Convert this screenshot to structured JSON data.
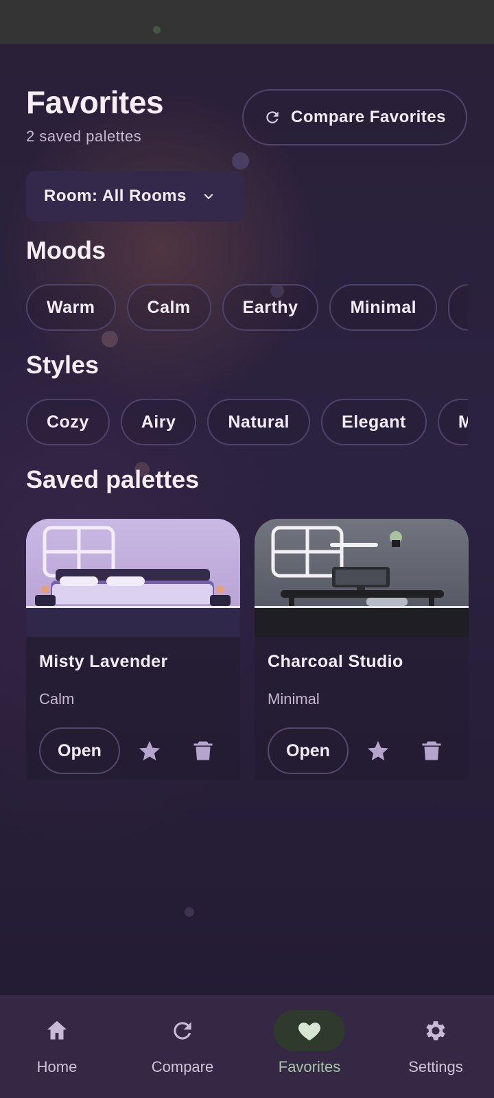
{
  "header": {
    "title": "Favorites",
    "subtitle": "2 saved palettes",
    "compare_button_label": "Compare Favorites",
    "compare_icon": "refresh-icon"
  },
  "room_filter": {
    "label": "Room: All Rooms",
    "icon": "chevron-down-icon"
  },
  "moods": {
    "title": "Moods",
    "chips": [
      "Warm",
      "Calm",
      "Earthy",
      "Minimal",
      ""
    ]
  },
  "styles": {
    "title": "Styles",
    "chips": [
      "Cozy",
      "Airy",
      "Natural",
      "Elegant",
      "M"
    ]
  },
  "saved": {
    "title": "Saved palettes",
    "cards": [
      {
        "name": "Misty Lavender",
        "mood": "Calm",
        "open_label": "Open",
        "image": "lavender-bedroom-illustration"
      },
      {
        "name": "Charcoal Studio",
        "mood": "Minimal",
        "open_label": "Open",
        "image": "charcoal-living-room-illustration"
      }
    ]
  },
  "bottom_nav": {
    "items": [
      {
        "label": "Home",
        "icon": "home-icon"
      },
      {
        "label": "Compare",
        "icon": "refresh-icon"
      },
      {
        "label": "Favorites",
        "icon": "heart-icon",
        "active": true
      },
      {
        "label": "Settings",
        "icon": "gear-icon"
      }
    ]
  },
  "colors": {
    "background": "#211a30",
    "accent_nav": "#a9c4a4",
    "chip_border": "#4f4268",
    "lavender": "#c9b8e0",
    "charcoal": "#5c6170"
  }
}
